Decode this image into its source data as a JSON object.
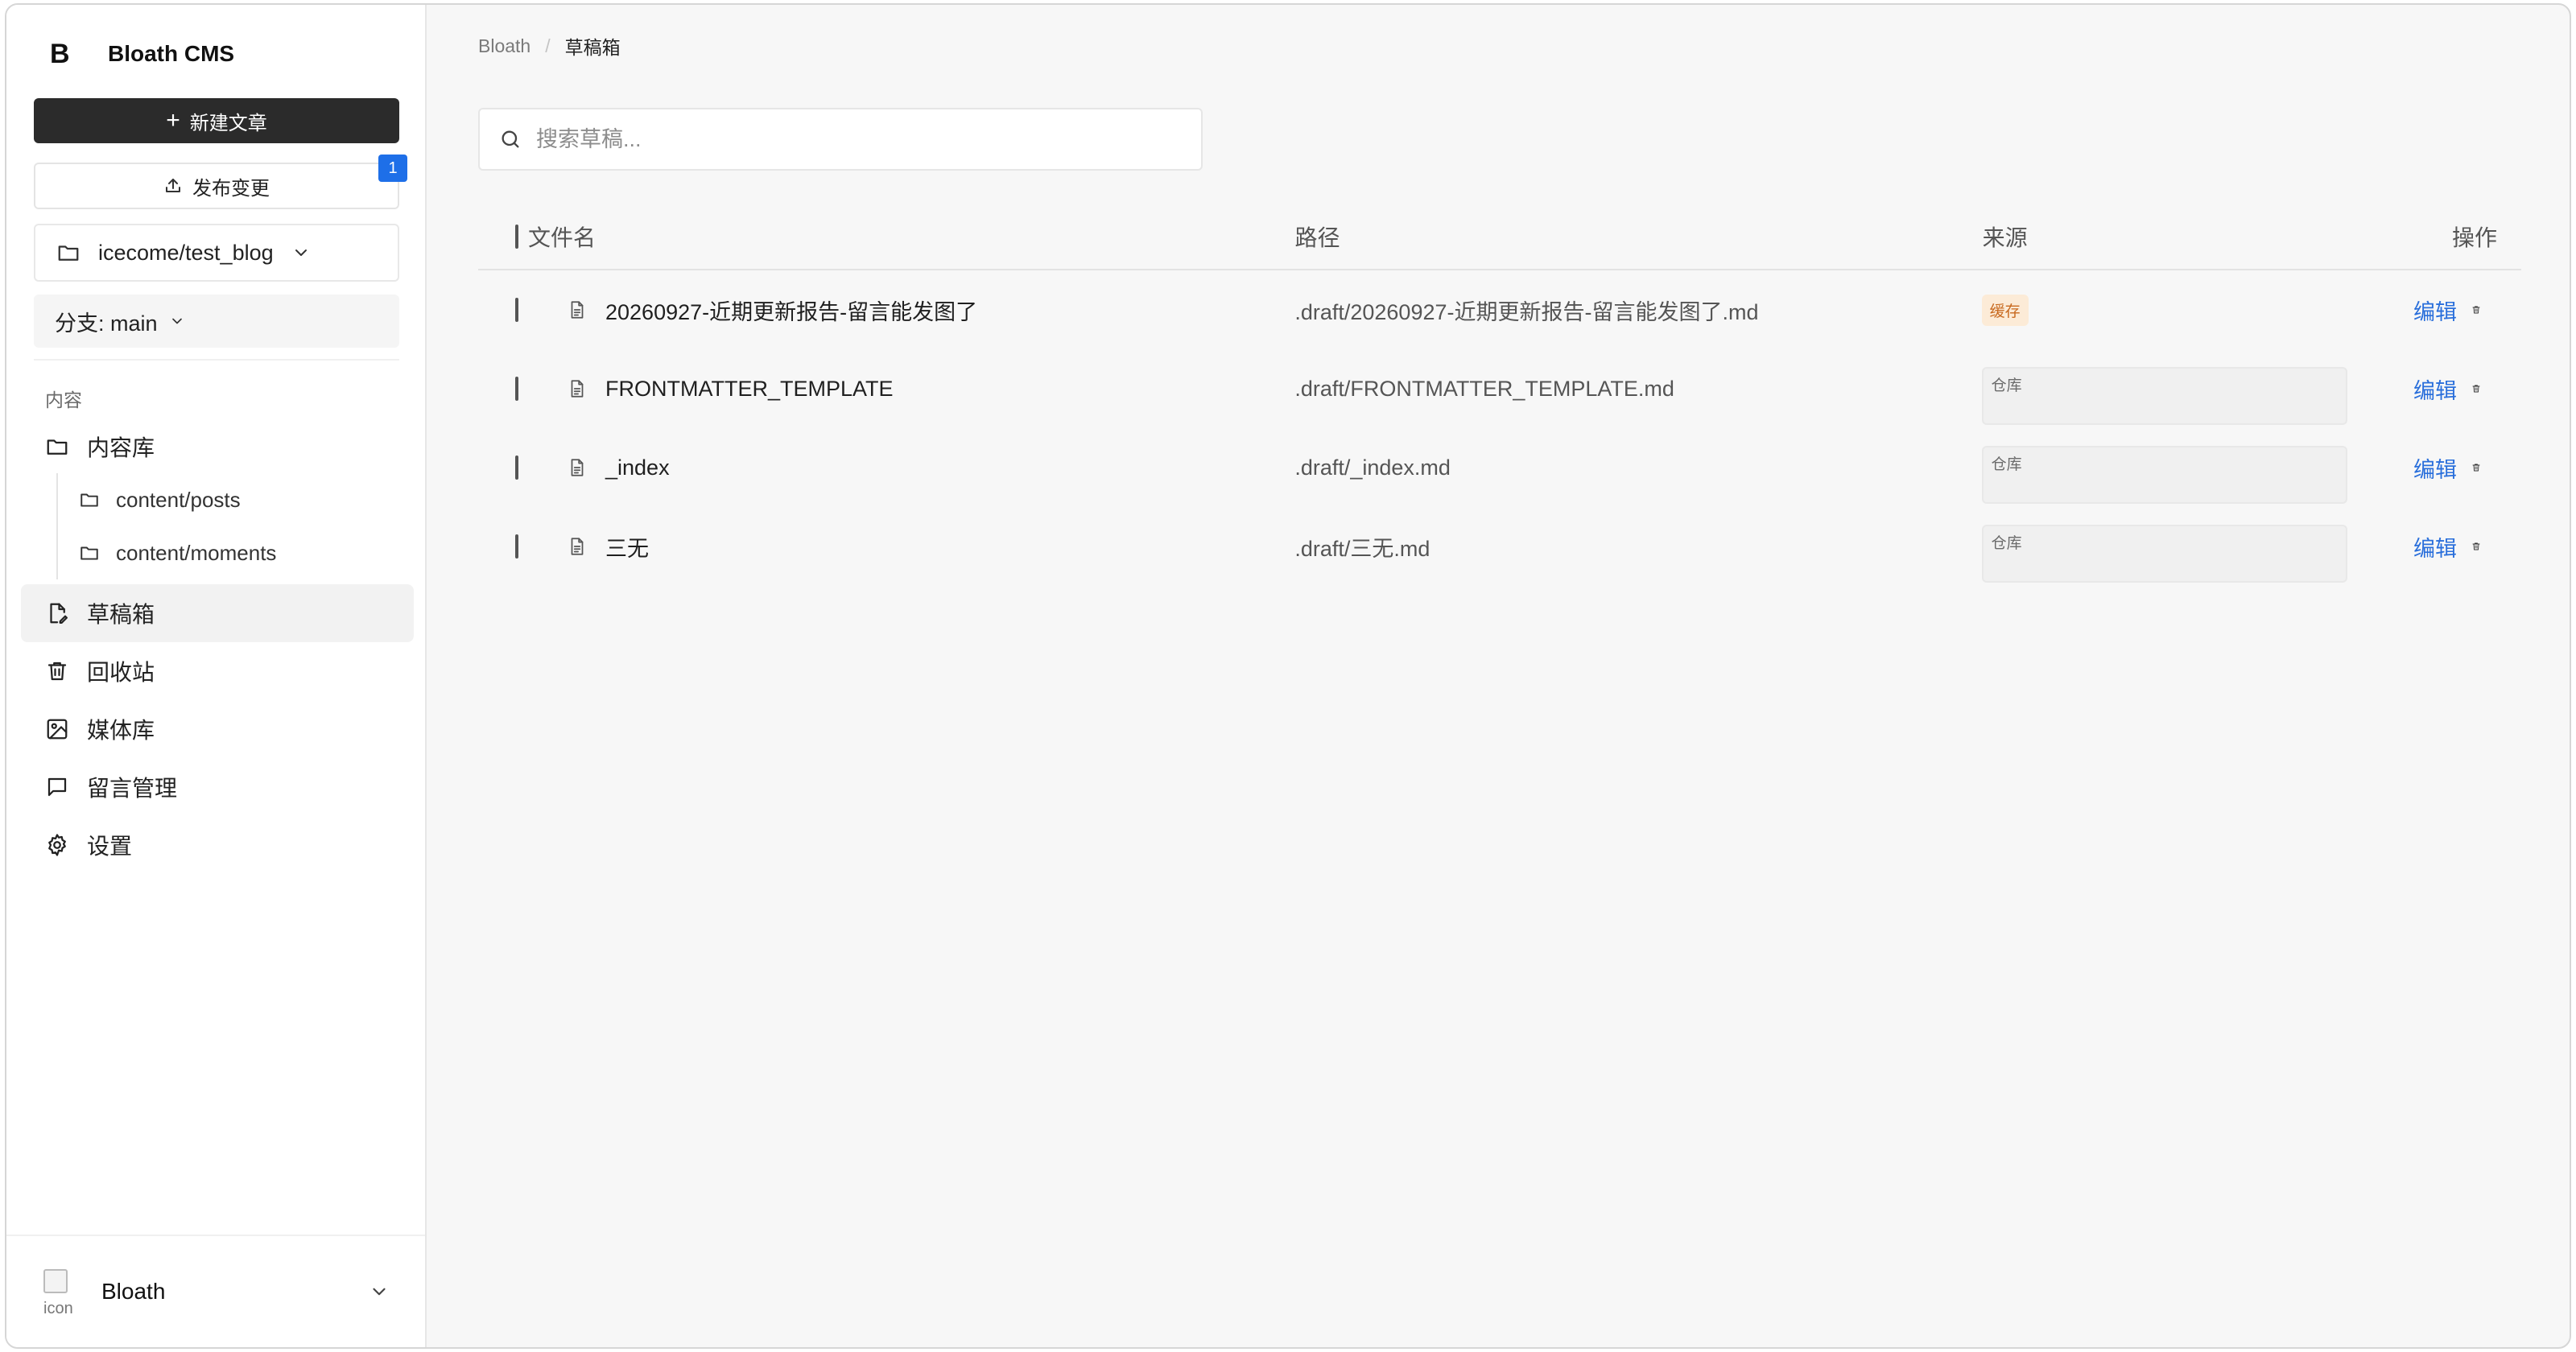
{
  "sidebar": {
    "brand_logo": "B",
    "brand_name": "Bloath CMS",
    "new_post_label": "新建文章",
    "publish_label": "发布变更",
    "publish_badge": "1",
    "repo": "icecome/test_blog",
    "branch": "分支: main",
    "section_label": "内容",
    "nav": {
      "library": "内容库",
      "sub_items": [
        "content/posts",
        "content/moments"
      ],
      "drafts": "草稿箱",
      "trash": "回收站",
      "media": "媒体库",
      "comments": "留言管理",
      "settings": "设置"
    },
    "user": {
      "avatar_alt": "icon",
      "name": "Bloath"
    }
  },
  "breadcrumb": {
    "root": "Bloath",
    "current": "草稿箱"
  },
  "search": {
    "placeholder": "搜索草稿..."
  },
  "table": {
    "headers": {
      "name": "文件名",
      "path": "路径",
      "source": "来源",
      "actions": "操作"
    },
    "edit_label": "编辑",
    "rows": [
      {
        "name": "20260927-近期更新报告-留言能发图了",
        "path": ".draft/20260927-近期更新报告-留言能发图了.md",
        "source": "缓存",
        "source_type": "cache"
      },
      {
        "name": "FRONTMATTER_TEMPLATE",
        "path": ".draft/FRONTMATTER_TEMPLATE.md",
        "source": "仓库",
        "source_type": "repo"
      },
      {
        "name": "_index",
        "path": ".draft/_index.md",
        "source": "仓库",
        "source_type": "repo"
      },
      {
        "name": "三无",
        "path": ".draft/三无.md",
        "source": "仓库",
        "source_type": "repo"
      }
    ]
  },
  "colors": {
    "primary_button": "#2b2b2b",
    "badge": "#1e6fe8",
    "link": "#2a6fdb",
    "cache_tag_bg": "#fcebd7",
    "cache_tag_text": "#c8691e"
  }
}
